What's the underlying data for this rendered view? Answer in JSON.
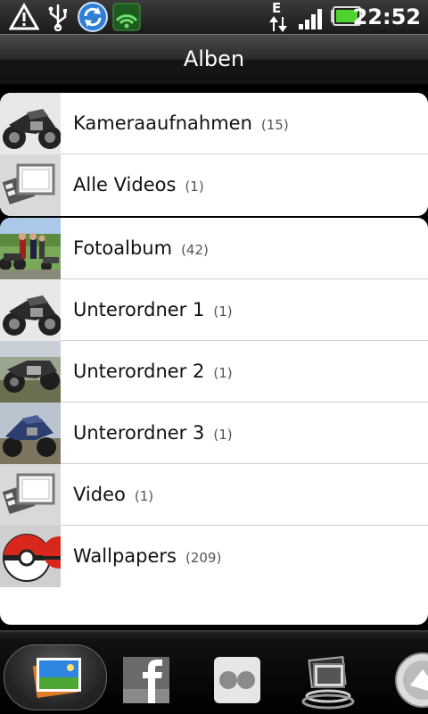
{
  "status_bar": {
    "time": "22:52",
    "network_type": "E",
    "icons": [
      "warning-icon",
      "usb-icon",
      "sync-icon",
      "security-shield-icon",
      "network-e-icon",
      "signal-icon",
      "battery-icon"
    ]
  },
  "header": {
    "title": "Alben"
  },
  "albums_top": [
    {
      "name": "Kameraaufnahmen",
      "count": "(15)",
      "thumb": "motorcycle"
    },
    {
      "name": "Alle Videos",
      "count": "(1)",
      "thumb": "video"
    }
  ],
  "albums": [
    {
      "name": "Fotoalbum",
      "count": "(42)",
      "thumb": "people"
    },
    {
      "name": "Unterordner 1",
      "count": "(1)",
      "thumb": "motorcycle"
    },
    {
      "name": "Unterordner 2",
      "count": "(1)",
      "thumb": "motorcycle-field"
    },
    {
      "name": "Unterordner 3",
      "count": "(1)",
      "thumb": "motorcycle-blue"
    },
    {
      "name": "Video",
      "count": "(1)",
      "thumb": "video"
    },
    {
      "name": "Wallpapers",
      "count": "(209)",
      "thumb": "pokeball"
    }
  ],
  "bottom_tabs": [
    {
      "name": "albums-tab",
      "icon": "photo-album-icon",
      "active": true
    },
    {
      "name": "facebook-tab",
      "icon": "facebook-icon",
      "active": false
    },
    {
      "name": "flickr-tab",
      "icon": "flickr-icon",
      "active": false
    },
    {
      "name": "slideshow-tab",
      "icon": "slideshow-icon",
      "active": false
    },
    {
      "name": "more-tab",
      "icon": "camera-icon",
      "active": false
    }
  ],
  "colors": {
    "header_text": "#ffffff",
    "list_bg": "#ffffff",
    "divider": "#cfcfcf",
    "battery": "#4ed22c"
  }
}
